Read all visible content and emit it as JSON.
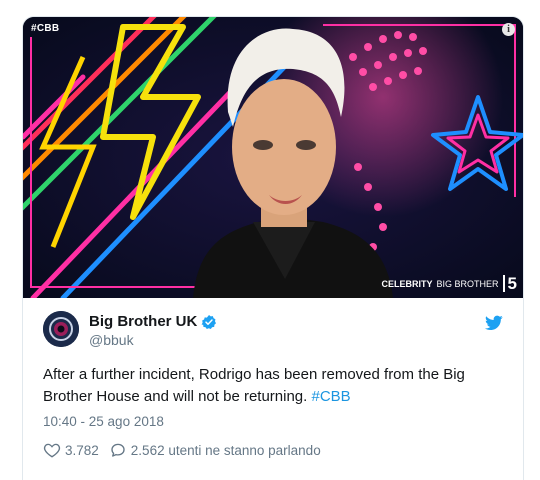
{
  "media": {
    "tag": "#CBB",
    "info_icon": "info-icon",
    "brand_prefix": "CELEBRITY",
    "brand_name": "BIG BROTHER",
    "brand_channel": "5",
    "colors": {
      "neon_yellow": "#f6e10c",
      "neon_pink": "#ff2fa4",
      "neon_blue": "#1e8fff",
      "background": "#0d1026"
    }
  },
  "tweet": {
    "author_name": "Big Brother UK",
    "author_handle": "@bbuk",
    "verified": true,
    "text_main": "After a further incident, Rodrigo has been removed from the Big Brother House and will not be returning.",
    "hashtag": "#CBB",
    "timestamp": "10:40 - 25 ago 2018",
    "likes": "3.782",
    "replies_text": "2.562 utenti ne stanno parlando",
    "accent_color": "#1da1f2"
  }
}
